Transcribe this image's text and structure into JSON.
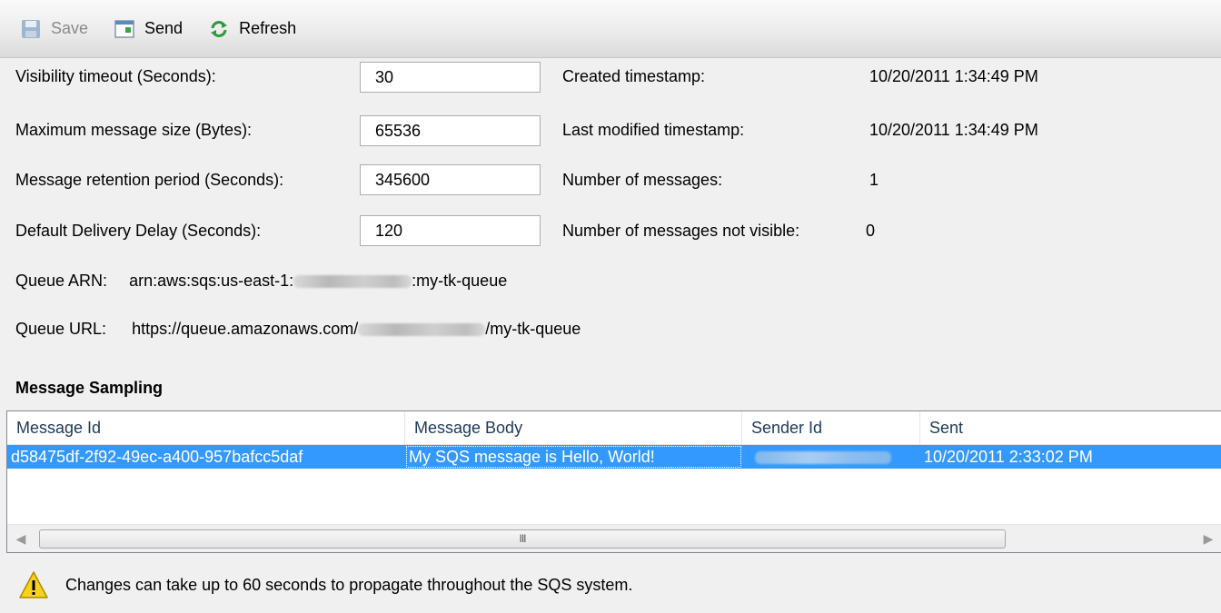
{
  "toolbar": {
    "save_label": "Save",
    "send_label": "Send",
    "refresh_label": "Refresh"
  },
  "settings": {
    "visibility_timeout_label": "Visibility timeout (Seconds):",
    "visibility_timeout_value": "30",
    "max_message_size_label": "Maximum message size (Bytes):",
    "max_message_size_value": "65536",
    "retention_period_label": "Message retention period (Seconds):",
    "retention_period_value": "345600",
    "delivery_delay_label": "Default Delivery Delay (Seconds):",
    "delivery_delay_value": "120"
  },
  "info": {
    "created_label": "Created timestamp:",
    "created_value": "10/20/2011 1:34:49 PM",
    "modified_label": "Last modified timestamp:",
    "modified_value": "10/20/2011 1:34:49 PM",
    "num_messages_label": "Number of messages:",
    "num_messages_value": "1",
    "not_visible_label": "Number of messages not visible:",
    "not_visible_value": "0"
  },
  "queue": {
    "arn_label": "Queue ARN:",
    "arn_prefix": "arn:aws:sqs:us-east-1:",
    "arn_suffix": ":my-tk-queue",
    "url_label": "Queue URL:",
    "url_prefix": "https://queue.amazonaws.com/",
    "url_suffix": "/my-tk-queue"
  },
  "sampling": {
    "title": "Message Sampling",
    "columns": [
      "Message Id",
      "Message Body",
      "Sender Id",
      "Sent"
    ],
    "rows": [
      {
        "message_id": "d58475df-2f92-49ec-a400-957bafcc5daf",
        "message_body": "My SQS message is Hello, World!",
        "sender_id": "",
        "sent": "10/20/2011 2:33:02 PM"
      }
    ],
    "scroll_thumb": "III"
  },
  "notice": {
    "text": "Changes can take up to 60 seconds to propagate throughout the SQS system.",
    "icon": "warning-icon"
  },
  "colors": {
    "selection": "#3399ff",
    "toolbar_bg": "#e6e6e6",
    "window_bg": "#f0f0f0"
  }
}
